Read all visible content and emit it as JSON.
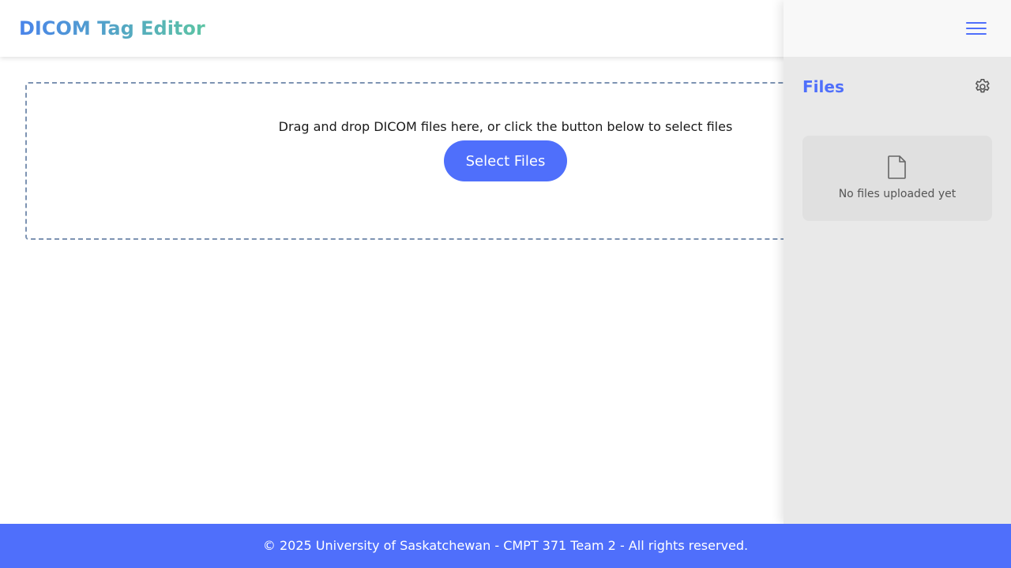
{
  "header": {
    "app_title": "DICOM Tag Editor"
  },
  "dropzone": {
    "instruction": "Drag and drop DICOM files here, or click the button below to select files",
    "select_button_label": "Select Files"
  },
  "sidebar": {
    "title": "Files",
    "empty_message": "No files uploaded yet",
    "icons": {
      "menu": "hamburger-menu-icon",
      "settings": "gear-icon",
      "empty": "file-icon"
    }
  },
  "footer": {
    "copyright": "© 2025 University of Saskatchewan - CMPT 371 Team 2 - All rights reserved."
  },
  "colors": {
    "accent": "#4f6ffb",
    "title_gradient_start": "#4a84ea",
    "title_gradient_end": "#5cc4a4",
    "sidebar_bg": "#e9e9e9",
    "dropzone_border": "#7d93b2"
  }
}
